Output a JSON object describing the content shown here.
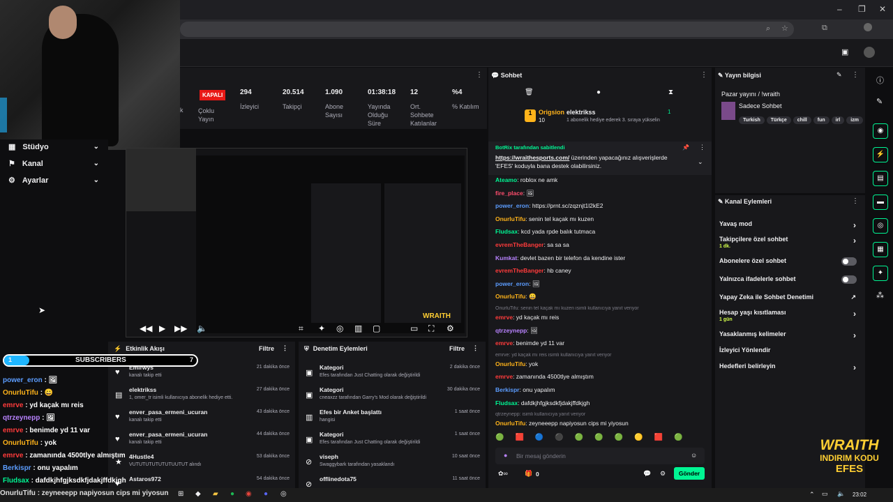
{
  "browser": {
    "controls": [
      "–",
      "❐",
      "✕"
    ]
  },
  "nav": {
    "studio": "Stüdyo",
    "kanal": "Kanal",
    "ayarlar": "Ayarlar"
  },
  "stats": {
    "status": "KAPALI",
    "multi": "Çoklu Yayın",
    "multi_prefix": "k",
    "items": [
      {
        "value": "294",
        "label": "İzleyici"
      },
      {
        "value": "20.514",
        "label": "Takipçi"
      },
      {
        "value": "1.090",
        "label": "Abone Sayısı"
      },
      {
        "value": "01:38:18",
        "label": "Yayında Olduğu Süre"
      },
      {
        "value": "12",
        "label": "Ort. Sohbete Katılanlar"
      },
      {
        "value": "%4",
        "label": "% Katılım"
      }
    ]
  },
  "activity": {
    "title": "Etkinlik Akışı",
    "filter": "Filtre",
    "rows": [
      {
        "name": "Emirwys",
        "desc": "kanalı takip etti",
        "time": "21 dakika önce"
      },
      {
        "name": "elektrikss",
        "desc": "1, omer_tr isimli kullanıcıya abonelik hediye etti.",
        "time": "27 dakika önce"
      },
      {
        "name": "enver_pasa_ermeni_ucuran",
        "desc": "kanalı takip etti",
        "time": "43 dakika önce"
      },
      {
        "name": "enver_pasa_ermeni_ucuran",
        "desc": "kanalı takip etti",
        "time": "44 dakika önce"
      },
      {
        "name": "4Hustle4",
        "desc": "VUTUTUTUTUTUTUUTUT alındı",
        "time": "53 dakika önce"
      },
      {
        "name": "Astaros972",
        "desc": "",
        "time": "54 dakika önce"
      }
    ]
  },
  "mod": {
    "title": "Denetim Eylemleri",
    "filter": "Filtre",
    "rows": [
      {
        "name": "Kategori",
        "desc": "Efes tarafından Just Chatting olarak değiştirildi",
        "time": "2 dakika önce"
      },
      {
        "name": "Kategori",
        "desc": "cneaxzz tarafından Garry's Mod olarak değiştirildi",
        "time": "30 dakika önce"
      },
      {
        "name": "Efes bir Anket başlattı",
        "desc": "hangisi",
        "time": "1 saat önce"
      },
      {
        "name": "Kategori",
        "desc": "Efes tarafından Just Chatting olarak değiştirildi",
        "time": "1 saat önce"
      },
      {
        "name": "viseph",
        "desc": "Swaggybark tarafından yasaklandı",
        "time": "10 saat önce"
      },
      {
        "name": "offlinedota75",
        "desc": "",
        "time": "11 saat önce"
      }
    ]
  },
  "chat": {
    "title": "Sohbet",
    "gifter": {
      "name": "Origsion",
      "count": "10",
      "target": "elektrikss",
      "num": "1",
      "msg": "1 abonelik hediye ederek 3. sıraya yükselin"
    },
    "pinned_by": "BotRix tarafından sabitlendi",
    "pinned_link": "https://wraithesports.com/",
    "pinned_text": " üzerinden yapacağınız alışverişlerde 'EFES' koduyla bana destek olabilirsiniz.",
    "messages": [
      {
        "user": "Ateamo",
        "color": "#00f593",
        "text": "roblox ne amk"
      },
      {
        "user": "fire_place",
        "color": "#ff4d6d",
        "text": "🖼"
      },
      {
        "user": "power_eron",
        "color": "#5c9dff",
        "text": "https://prnt.sc/zqznjt1l2kE2"
      },
      {
        "user": "OnurluTifu",
        "color": "#ffb31a",
        "text": "senin tel kaçak mı kuzen"
      },
      {
        "user": "Fludsax",
        "color": "#00f593",
        "text": "kcd yada rpde balık tutmaca"
      },
      {
        "user": "evremTheBanger",
        "color": "#ff3b3b",
        "text": "sa sa sa"
      },
      {
        "user": "Kumkat",
        "color": "#b983ff",
        "text": "devlet bazen bir telefon da kendine ister"
      },
      {
        "user": "evremTheBanger",
        "color": "#ff3b3b",
        "text": "hb caney"
      },
      {
        "user": "power_eron",
        "color": "#5c9dff",
        "text": "🖼"
      },
      {
        "user": "OnurluTifu",
        "color": "#ffb31a",
        "text": "😀"
      },
      {
        "user": "emrve",
        "color": "#ff3b3b",
        "text": "yd kaçak mı reis",
        "reply": "OnurluTifu: senin tel kaçak mı kuzen isimli kullanıcıya yanıt veriyor"
      },
      {
        "user": "qtrzeynepp",
        "color": "#b983ff",
        "text": "🖼"
      },
      {
        "user": "emrve",
        "color": "#ff3b3b",
        "text": "benimde yd 11 var"
      },
      {
        "user": "OnurluTifu",
        "color": "#ffb31a",
        "text": "yok",
        "reply": "emrve: yd kaçak mı reis isimli kullanıcıya yanıt veriyor"
      },
      {
        "user": "emrve",
        "color": "#ff3b3b",
        "text": "zamanında 4500tlye almıştım"
      },
      {
        "user": "Berkispr",
        "color": "#5c9dff",
        "text": "onu yapalım"
      },
      {
        "user": "Fludsax",
        "color": "#00f593",
        "text": "dafdkjhfgjksdkfjdakjffdkjgh"
      },
      {
        "user": "OnurluTifu",
        "color": "#ffb31a",
        "text": "zeyneeepp napiyosun cips mi yiyosun",
        "reply": "qtrzeynepp: isimli kullanıcıya yanıt veriyor"
      }
    ],
    "input_placeholder": "Bir mesaj gönderin",
    "points": "0",
    "send": "Gönder"
  },
  "info": {
    "title": "Yayın bilgisi",
    "stream_title": "Pazar yayını / !wraith",
    "category": "Sadece Sohbet",
    "tags": [
      "Turkish",
      "Türkçe",
      "chill",
      "fun",
      "irl",
      "izm"
    ]
  },
  "actions": {
    "title": "Kanal Eylemleri",
    "items": [
      {
        "label": "Yavaş mod",
        "sub": "",
        "type": "arrow"
      },
      {
        "label": "Takipçilere özel sohbet",
        "sub": "1 dk.",
        "type": "arrow"
      },
      {
        "label": "Abonelere özel sohbet",
        "sub": "",
        "type": "toggle"
      },
      {
        "label": "Yalnızca ifadelerle sohbet",
        "sub": "",
        "type": "toggle"
      },
      {
        "label": "Yapay Zeka ile Sohbet Denetimi",
        "sub": "",
        "type": "ext"
      },
      {
        "label": "Hesap yaşı kısıtlaması",
        "sub": "1 gün",
        "type": "arrow"
      },
      {
        "label": "Yasaklanmış kelimeler",
        "sub": "",
        "type": "arrow"
      },
      {
        "label": "İzleyici Yönlendir",
        "sub": "",
        "type": "none"
      },
      {
        "label": "Hedefleri belirleyin",
        "sub": "",
        "type": "arrow"
      }
    ]
  },
  "overlay": {
    "subs_label": "SUBSCRIBERS",
    "subs_count": "7",
    "subs_start": "1",
    "lines": [
      {
        "user": "power_eron",
        "color": "#5c9dff",
        "text": " : 🖼"
      },
      {
        "user": "OnurluTifu",
        "color": "#ffb31a",
        "text": " : 😀"
      },
      {
        "user": "emrve",
        "color": "#ff3b3b",
        "text": " : yd kaçak mı reis"
      },
      {
        "user": "qtrzeynepp",
        "color": "#b983ff",
        "text": " : 🖼"
      },
      {
        "user": "emrve",
        "color": "#ff3b3b",
        "text": " : benimde yd 11 var"
      },
      {
        "user": "OnurluTifu",
        "color": "#ffb31a",
        "text": " : yok"
      },
      {
        "user": "emrve",
        "color": "#ff3b3b",
        "text": " : zamanında 4500tlye almıştım"
      },
      {
        "user": "Berkispr",
        "color": "#5c9dff",
        "text": " : onu yapalım"
      },
      {
        "user": "Fludsax",
        "color": "#00f593",
        "text": " : dafdkjhfgjksdkfjdakjffdkjgh"
      }
    ]
  },
  "ticker": "OnurluTifu : zeyneeepp napiyosun cips mi yiyosun",
  "wraith": {
    "line1": "WRAITH",
    "line2": "INDIRIM KODU",
    "line3": "EFES"
  },
  "taskbar": {
    "time": "23:02"
  },
  "colors": {
    "accent": "#00f593",
    "live": "#e91916",
    "send": "#00f593"
  }
}
